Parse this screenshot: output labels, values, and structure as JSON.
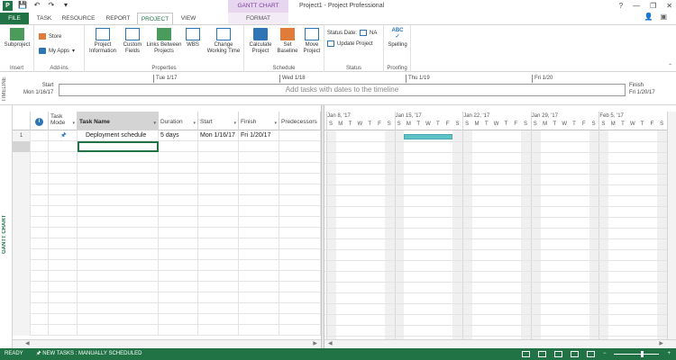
{
  "titlebar": {
    "app_icon": "P",
    "context_tool": "GANTT CHART TOOLS",
    "window_title": "Project1 - Project Professional",
    "help": "?",
    "minimize": "—",
    "restore": "❐",
    "close": "✕"
  },
  "tabs": {
    "file": "FILE",
    "task": "TASK",
    "resource": "RESOURCE",
    "report": "REPORT",
    "project": "PROJECT",
    "view": "VIEW",
    "format": "FORMAT"
  },
  "ribbon": {
    "insert": {
      "subproject": "Subproject",
      "label": "Insert"
    },
    "addins": {
      "store": "Store",
      "myapps": "My Apps",
      "label": "Add-ins"
    },
    "properties": {
      "project_information": "Project Information",
      "custom_fields": "Custom Fields",
      "links_between_projects": "Links Between Projects",
      "wbs": "WBS",
      "change_working_time": "Change Working Time",
      "label": "Properties"
    },
    "schedule": {
      "calculate_project": "Calculate Project",
      "set_baseline": "Set Baseline",
      "move_project": "Move Project",
      "label": "Schedule"
    },
    "status": {
      "status_date_label": "Status Date:",
      "status_date_value": "NA",
      "update_project": "Update Project",
      "label": "Status"
    },
    "proofing": {
      "spelling": "Spelling",
      "spelling_icon_text": "ABC",
      "label": "Proofing"
    }
  },
  "timeline": {
    "vertical_label": "TIMELINE",
    "ticks": [
      "Tue 1/17",
      "Wed 1/18",
      "Thu 1/19",
      "Fri 1/20"
    ],
    "placeholder": "Add tasks with dates to the timeline",
    "start_label": "Start",
    "start_date": "Mon 1/16/17",
    "finish_label": "Finish",
    "finish_date": "Fri 1/20/17"
  },
  "view": {
    "vertical_label": "GANTT CHART"
  },
  "grid": {
    "headers": {
      "task_mode": "Task Mode",
      "task_name": "Task Name",
      "duration": "Duration",
      "start": "Start",
      "finish": "Finish",
      "predecessors": "Predecessors"
    },
    "rows": [
      {
        "id": "1",
        "name": "Deployment schedule",
        "duration": "5 days",
        "start": "Mon 1/16/17",
        "finish": "Fri 1/20/17",
        "predecessors": ""
      }
    ]
  },
  "gantt": {
    "weeks": [
      "Jan 8, '17",
      "Jan 15, '17",
      "Jan 22, '17",
      "Jan 29, '17",
      "Feb 5, '17"
    ],
    "day_letters": [
      "S",
      "M",
      "T",
      "W",
      "T",
      "F",
      "S"
    ]
  },
  "statusbar": {
    "ready": "READY",
    "new_tasks": "NEW TASKS : MANUALLY SCHEDULED"
  },
  "colors": {
    "accent": "#217346",
    "task_bar": "#5fc2c7",
    "context_tab": "#e8d5ef"
  }
}
